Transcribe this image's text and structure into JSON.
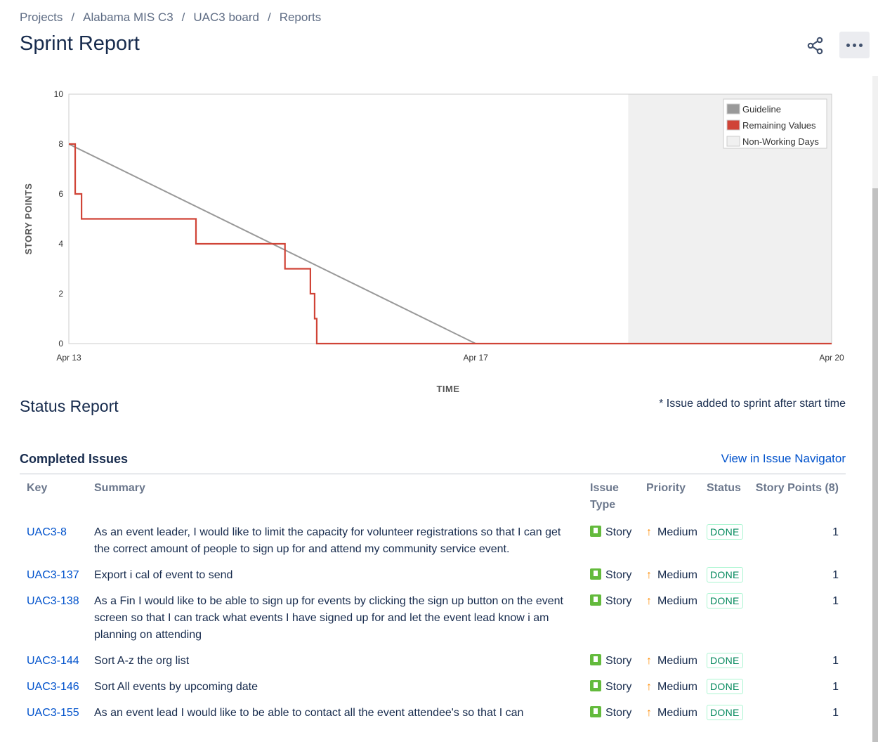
{
  "breadcrumb": {
    "items": [
      "Projects",
      "Alabama MIS C3",
      "UAC3 board",
      "Reports"
    ],
    "separator": "/"
  },
  "page_title": "Sprint Report",
  "header_actions": {
    "share_icon": "share-icon",
    "more_icon": "more-icon"
  },
  "chart_data": {
    "type": "line",
    "title": "",
    "xlabel": "TIME",
    "ylabel": "STORY POINTS",
    "ylim": [
      0,
      10
    ],
    "yticks": [
      0,
      2,
      4,
      6,
      8,
      10
    ],
    "xlim": [
      "2019-04-13",
      "2019-04-20"
    ],
    "xticks": [
      "Apr 13",
      "Apr 17",
      "Apr 20"
    ],
    "non_working_days": [
      [
        "2019-04-18 12:00",
        "2019-04-20 12:00"
      ]
    ],
    "legend_placement": "top-right",
    "legend": [
      {
        "name": "Guideline",
        "color": "#999999"
      },
      {
        "name": "Remaining Values",
        "color": "#d04437"
      },
      {
        "name": "Non-Working Days",
        "color": "#f0f0f0"
      }
    ],
    "series": [
      {
        "name": "Guideline",
        "color": "#999999",
        "points": [
          [
            "2019-04-13 00:00",
            8
          ],
          [
            "2019-04-17 00:00",
            0
          ]
        ]
      },
      {
        "name": "Remaining Values",
        "color": "#d04437",
        "step": true,
        "points": [
          [
            "2019-04-13 00:00",
            8
          ],
          [
            "2019-04-13 01:30",
            6
          ],
          [
            "2019-04-13 03:00",
            5
          ],
          [
            "2019-04-14 06:00",
            4
          ],
          [
            "2019-04-15 03:00",
            3
          ],
          [
            "2019-04-15 09:00",
            2
          ],
          [
            "2019-04-15 10:00",
            1
          ],
          [
            "2019-04-15 10:30",
            0
          ],
          [
            "2019-04-20 12:00",
            0
          ]
        ]
      }
    ]
  },
  "status_report": {
    "title": "Status Report",
    "note": "* Issue added to sprint after start time"
  },
  "completed": {
    "title": "Completed Issues",
    "navigator_link": "View in Issue Navigator",
    "headers": {
      "key": "Key",
      "summary": "Summary",
      "type": "Issue Type",
      "priority": "Priority",
      "status": "Status",
      "points": "Story Points (8)"
    },
    "rows": [
      {
        "key": "UAC3-8",
        "summary": "As an event leader, I would like to limit the capacity for volunteer registrations so that I can get the correct amount of people to sign up for and attend my community service event.",
        "type": "Story",
        "priority": "Medium",
        "status": "DONE",
        "points": "1"
      },
      {
        "key": "UAC3-137",
        "summary": "Export i cal of event to send",
        "type": "Story",
        "priority": "Medium",
        "status": "DONE",
        "points": "1"
      },
      {
        "key": "UAC3-138",
        "summary": "As a Fin I would like to be able to sign up for events by clicking the sign up button on the event screen so that I can track what events I have signed up for and let the event lead know i am planning on attending",
        "type": "Story",
        "priority": "Medium",
        "status": "DONE",
        "points": "1"
      },
      {
        "key": "UAC3-144",
        "summary": "Sort A-z the org list",
        "type": "Story",
        "priority": "Medium",
        "status": "DONE",
        "points": "1"
      },
      {
        "key": "UAC3-146",
        "summary": "Sort All events by upcoming date",
        "type": "Story",
        "priority": "Medium",
        "status": "DONE",
        "points": "1"
      },
      {
        "key": "UAC3-155",
        "summary": "As an event lead I would like to be able to contact all the event attendee's so that I can",
        "type": "Story",
        "priority": "Medium",
        "status": "DONE",
        "points": "1"
      }
    ]
  }
}
